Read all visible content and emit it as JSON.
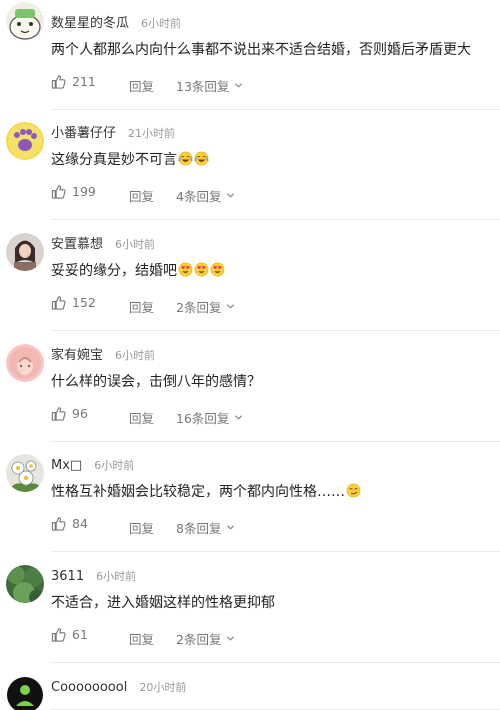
{
  "comments": [
    {
      "username": "数星星的冬瓜",
      "time": "6小时前",
      "text": "两个人都那么内向什么事都不说出来不适合结婚，否则婚后矛盾更大",
      "likes": "211",
      "reply_label": "回复",
      "replies_label": "13条回复"
    },
    {
      "username": "小番薯仔仔",
      "time": "21小时前",
      "text": "这缘分真是妙不可言",
      "likes": "199",
      "reply_label": "回复",
      "replies_label": "4条回复"
    },
    {
      "username": "安置慕想",
      "time": "6小时前",
      "text": "妥妥的缘分，结婚吧",
      "likes": "152",
      "reply_label": "回复",
      "replies_label": "2条回复"
    },
    {
      "username": "家有婉宝",
      "time": "6小时前",
      "text": "什么样的误会，击倒八年的感情？",
      "likes": "96",
      "reply_label": "回复",
      "replies_label": "16条回复"
    },
    {
      "username": "Mx□",
      "time": "6小时前",
      "text": "性格互补婚姻会比较稳定，两个都内向性格……",
      "likes": "84",
      "reply_label": "回复",
      "replies_label": "8条回复"
    },
    {
      "username": "3611",
      "time": "6小时前",
      "text": "不适合，进入婚姻这样的性格更抑郁",
      "likes": "61",
      "reply_label": "回复",
      "replies_label": "2条回复"
    },
    {
      "username": "Cooooooool",
      "time": "20小时前",
      "text": "",
      "likes": "",
      "reply_label": "",
      "replies_label": ""
    }
  ],
  "icons": {
    "like": "thumbs-up-icon",
    "expand": "chevron-down-icon",
    "emoji_laugh_cry": "laugh-cry-emoji-icon",
    "emoji_heart_eyes": "heart-eyes-emoji-icon",
    "emoji_smirk": "smirk-emoji-icon"
  },
  "colors": {
    "text_main": "#222222",
    "text_meta": "#999999",
    "text_action": "#777777",
    "divider": "#ececec"
  }
}
